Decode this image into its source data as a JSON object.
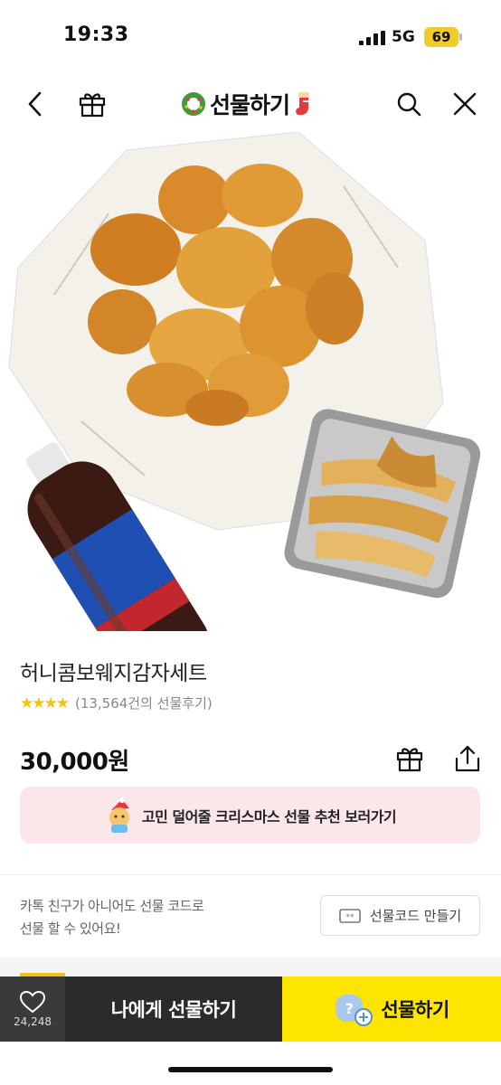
{
  "status_bar": {
    "time": "19:33",
    "network": "5G",
    "battery": "69"
  },
  "nav": {
    "title": "선물하기",
    "icons": [
      "back-icon",
      "gift-box-icon",
      "search-icon",
      "close-icon"
    ]
  },
  "product": {
    "name": "허니콤보웨지감자세트",
    "stars": "★★★★",
    "review_text": "(13,564건의 선물후기)",
    "price": "30,000원"
  },
  "promo": {
    "text": "고민 덜어줄 크리스마스 선물 추천 보러가기"
  },
  "gift_code": {
    "line1": "카톡 친구가 아니어도 선물 코드로",
    "line2": "선물 할 수 있어요!",
    "button_label": "선물코드 만들기"
  },
  "bottom_bar": {
    "like_count": "24,248",
    "self_gift_label": "나에게 선물하기",
    "gift_label": "선물하기"
  },
  "colors": {
    "accent": "#fee500",
    "promo_bg": "#fbe7ea",
    "star": "#f5c20d",
    "dark": "#2b2b2b"
  }
}
